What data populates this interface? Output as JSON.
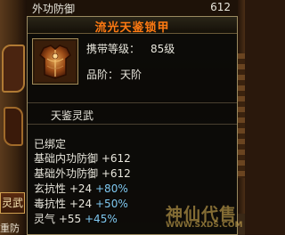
{
  "header": {
    "label": "外功防御",
    "value": "612"
  },
  "tooltip": {
    "title": "流光天鉴锁甲",
    "icon": "armor-chestplate-icon",
    "level_label": "携带等级：",
    "level_value": "85级",
    "tier_label": "品阶：",
    "tier_value": "天阶",
    "set_name": "天鉴灵武",
    "bound": "已绑定",
    "stats": [
      {
        "name": "基础内功防御",
        "value": "+612",
        "bonus": ""
      },
      {
        "name": "基础外功防御",
        "value": "+612",
        "bonus": ""
      },
      {
        "name": "玄抗性",
        "value": "+24",
        "bonus": "+80%"
      },
      {
        "name": "毒抗性",
        "value": "+24",
        "bonus": "+50%"
      },
      {
        "name": "灵气",
        "value": "+55",
        "bonus": "+45%"
      }
    ]
  },
  "left_panel": {
    "button_label": "灵武",
    "bottom_text": "重防"
  },
  "watermark": {
    "logo": "神仙代售",
    "url": "WWW.SXDS.COM"
  },
  "colors": {
    "title": "#ff7a12",
    "bonus": "#7ec8f0",
    "text": "#e8e6dc",
    "border": "#9a8a60"
  }
}
